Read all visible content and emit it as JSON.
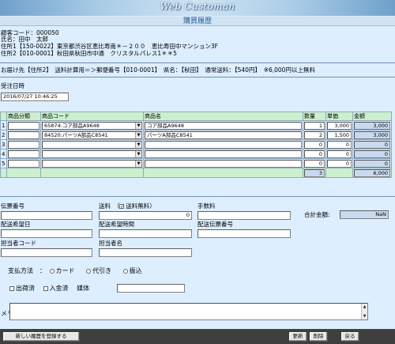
{
  "app": {
    "title": "Web Customan",
    "page_title": "購買履歴"
  },
  "customer": {
    "code_line": "顧客コード：000050",
    "name_line": "氏名：田中　太郎",
    "addr1_line": "住所1【150-0022】東京都渋谷区恵比寿南＊－２００　恵比寿田中マンション3F",
    "addr2_line": "住所2【010-0001】秋田県秋田市中通　クリスタルパレス1＊＊5"
  },
  "delivery_line": "お届け先【住所2】　送料計算用＝＞郵便番号【010-0001】　県名：【秋田】　通常送料：【540円】　※6,000円以上無料",
  "order": {
    "date_label": "受注日時",
    "date_value": "2016/07/27 10:46:25"
  },
  "table": {
    "headers": {
      "category": "商品分類",
      "code": "商品コード",
      "name": "商品名",
      "qty": "数量",
      "price": "単価",
      "amount": "金額"
    },
    "rows": [
      {
        "no": "1",
        "code": "65874:コア部品A9648",
        "name": "コア部品A9648",
        "qty": "1",
        "price": "3,000",
        "amount": "3,000"
      },
      {
        "no": "2",
        "code": "84520:パーツA部品C8541",
        "name": "パーツA部品C8541",
        "qty": "2",
        "price": "1,500",
        "amount": "3,000"
      },
      {
        "no": "3",
        "code": "",
        "name": "",
        "qty": "0",
        "price": "0",
        "amount": "0"
      },
      {
        "no": "4",
        "code": "",
        "name": "",
        "qty": "0",
        "price": "0",
        "amount": "0"
      },
      {
        "no": "5",
        "code": "",
        "name": "",
        "qty": "0",
        "price": "0",
        "amount": "0"
      }
    ],
    "totals": {
      "qty": "3",
      "amount": "6,000"
    }
  },
  "fields": {
    "slip_no_label": "伝票番号",
    "shipping_label": "送料",
    "shipping_free_label": "送料無料",
    "shipping_value": "0",
    "fee_label": "手数料",
    "total_label": "合計金額:",
    "total_value": "NaN",
    "desired_date_label": "配送希望日",
    "desired_time_label": "配送希望時間",
    "delivery_slip_label": "配送伝票番号",
    "staff_code_label": "担当者コード",
    "staff_name_label": "担当者名"
  },
  "payment": {
    "label": "支払方法　：",
    "options": [
      "カード",
      "代引き",
      "振込"
    ],
    "shipped_label": "出荷済",
    "paid_label": "入金済",
    "media_label": "媒体"
  },
  "memo_label": "メモ",
  "buttons": {
    "register": "新しい履歴を登録する",
    "update": "更新",
    "delete": "削除",
    "back": "戻る"
  },
  "icons": {
    "dropdown": "chevron-down-icon",
    "scroll_up": "scroll-up-icon",
    "scroll_down": "scroll-down-icon"
  }
}
